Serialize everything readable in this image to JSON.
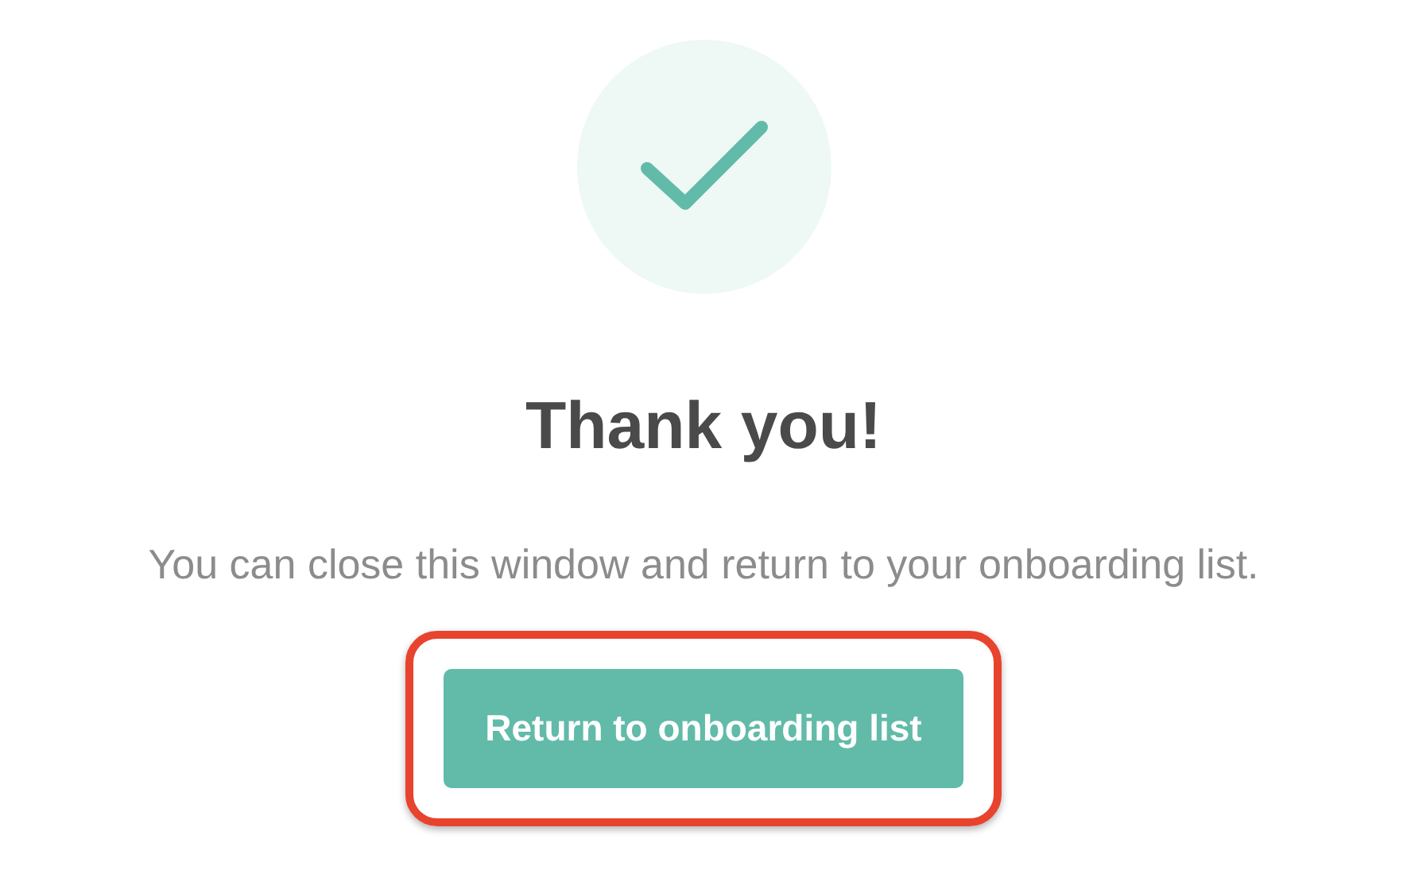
{
  "title": "Thank you!",
  "message": "You can close this window and return to your onboarding list.",
  "button": {
    "label": "Return to onboarding list",
    "highlighted": true
  }
}
